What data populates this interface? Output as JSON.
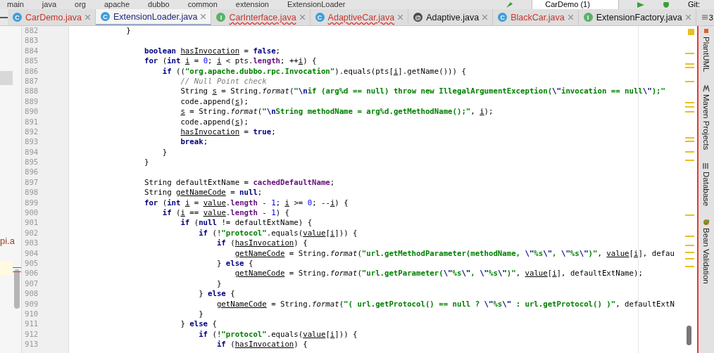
{
  "breadcrumbs": [
    "main",
    "java",
    "org",
    "apache",
    "dubbo",
    "common",
    "extension",
    "ExtensionLoader"
  ],
  "toolbar": {
    "run_config": "CarDemo (1)",
    "vcs_label": "Git:"
  },
  "project_panel": {
    "visible_text": "pi.a"
  },
  "tabs": [
    {
      "label": "CarDemo.java",
      "badge": "C",
      "kind": "class",
      "selected": false,
      "unversioned": true,
      "has_errors": false
    },
    {
      "label": "ExtensionLoader.java",
      "badge": "C",
      "kind": "class",
      "selected": true,
      "unversioned": false,
      "has_errors": false
    },
    {
      "label": "CarInterface.java",
      "badge": "I",
      "kind": "interface",
      "selected": false,
      "unversioned": true,
      "has_errors": true
    },
    {
      "label": "AdaptiveCar.java",
      "badge": "C",
      "kind": "class",
      "selected": false,
      "unversioned": true,
      "has_errors": true
    },
    {
      "label": "Adaptive.java",
      "badge": "@",
      "kind": "annotation",
      "selected": false,
      "unversioned": false,
      "has_errors": false
    },
    {
      "label": "BlackCar.java",
      "badge": "C",
      "kind": "class",
      "selected": false,
      "unversioned": true,
      "has_errors": false
    },
    {
      "label": "ExtensionFactory.java",
      "badge": "I",
      "kind": "interface",
      "selected": false,
      "unversioned": false,
      "has_errors": false
    }
  ],
  "tabs_overflow": "3",
  "editor": {
    "lines": [
      {
        "no": "882",
        "code": [
          {
            "text": "            }",
            "kind": "plain"
          }
        ]
      },
      {
        "no": "883"
      },
      {
        "no": "884",
        "code": [
          {
            "text": "                boolean ",
            "kind": "keyword"
          },
          {
            "text": "hasInvocation",
            "kind": "variable"
          },
          {
            "text": " = ",
            "kind": "plain"
          },
          {
            "text": "false",
            "kind": "keyword"
          },
          {
            "text": ";",
            "kind": "plain"
          }
        ]
      },
      {
        "no": "885",
        "code": [
          {
            "text": "                for",
            "kind": "keyword"
          },
          {
            "text": " (",
            "kind": "plain"
          },
          {
            "text": "int ",
            "kind": "keyword"
          },
          {
            "text": "i",
            "kind": "variable"
          },
          {
            "text": " = ",
            "kind": "plain"
          },
          {
            "text": "0",
            "kind": "number"
          },
          {
            "text": "; ",
            "kind": "plain"
          },
          {
            "text": "i",
            "kind": "variable"
          },
          {
            "text": " < pts.",
            "kind": "plain"
          },
          {
            "text": "length",
            "kind": "field"
          },
          {
            "text": "; ++",
            "kind": "plain"
          },
          {
            "text": "i",
            "kind": "variable"
          },
          {
            "text": ") {",
            "kind": "plain"
          }
        ]
      },
      {
        "no": "886",
        "code": [
          {
            "text": "                    if",
            "kind": "keyword"
          },
          {
            "text": " ((",
            "kind": "plain"
          },
          {
            "text": "\"org.apache.dubbo.rpc.Invocation\"",
            "kind": "string"
          },
          {
            "text": ").equals(pts[",
            "kind": "plain"
          },
          {
            "text": "i",
            "kind": "variable"
          },
          {
            "text": "].getName())) {",
            "kind": "plain"
          }
        ]
      },
      {
        "no": "887",
        "code": [
          {
            "text": "                        // Null Point check",
            "kind": "comment"
          }
        ]
      },
      {
        "no": "888",
        "code": [
          {
            "text": "                        String ",
            "kind": "plain"
          },
          {
            "text": "s",
            "kind": "variable"
          },
          {
            "text": " = String.",
            "kind": "plain"
          },
          {
            "text": "format",
            "kind": "method"
          },
          {
            "text": "(",
            "kind": "plain"
          },
          {
            "text": "\"",
            "kind": "string"
          },
          {
            "text": "\\n",
            "kind": "escape"
          },
          {
            "text": "if (arg%d == null) throw new IllegalArgumentException(",
            "kind": "string"
          },
          {
            "text": "\\\"",
            "kind": "escape"
          },
          {
            "text": "invocation == null",
            "kind": "string"
          },
          {
            "text": "\\\"",
            "kind": "escape"
          },
          {
            "text": ");\"",
            "kind": "string"
          }
        ]
      },
      {
        "no": "889",
        "code": [
          {
            "text": "                        code.append(",
            "kind": "plain"
          },
          {
            "text": "s",
            "kind": "variable"
          },
          {
            "text": ");",
            "kind": "plain"
          }
        ]
      },
      {
        "no": "890",
        "code": [
          {
            "text": "                        s",
            "kind": "variable"
          },
          {
            "text": " = String.",
            "kind": "plain"
          },
          {
            "text": "format",
            "kind": "method"
          },
          {
            "text": "(",
            "kind": "plain"
          },
          {
            "text": "\"",
            "kind": "string"
          },
          {
            "text": "\\n",
            "kind": "escape"
          },
          {
            "text": "String methodName = arg%d.getMethodName();\"",
            "kind": "string"
          },
          {
            "text": ", ",
            "kind": "plain"
          },
          {
            "text": "i",
            "kind": "variable"
          },
          {
            "text": ");",
            "kind": "plain"
          }
        ]
      },
      {
        "no": "891",
        "code": [
          {
            "text": "                        code.append(",
            "kind": "plain"
          },
          {
            "text": "s",
            "kind": "variable"
          },
          {
            "text": ");",
            "kind": "plain"
          }
        ]
      },
      {
        "no": "892",
        "code": [
          {
            "text": "                        hasInvocation",
            "kind": "variable"
          },
          {
            "text": " = ",
            "kind": "plain"
          },
          {
            "text": "true",
            "kind": "keyword"
          },
          {
            "text": ";",
            "kind": "plain"
          }
        ]
      },
      {
        "no": "893",
        "code": [
          {
            "text": "                        break",
            "kind": "keyword"
          },
          {
            "text": ";",
            "kind": "plain"
          }
        ]
      },
      {
        "no": "894",
        "code": [
          {
            "text": "                    }",
            "kind": "plain"
          }
        ]
      },
      {
        "no": "895",
        "code": [
          {
            "text": "                }",
            "kind": "plain"
          }
        ]
      },
      {
        "no": "896"
      },
      {
        "no": "897",
        "code": [
          {
            "text": "                String defaultExtName = ",
            "kind": "plain"
          },
          {
            "text": "cachedDefaultName",
            "kind": "field"
          },
          {
            "text": ";",
            "kind": "plain"
          }
        ]
      },
      {
        "no": "898",
        "code": [
          {
            "text": "                String ",
            "kind": "plain"
          },
          {
            "text": "getNameCode",
            "kind": "variable"
          },
          {
            "text": " = ",
            "kind": "plain"
          },
          {
            "text": "null",
            "kind": "keyword"
          },
          {
            "text": ";",
            "kind": "plain"
          }
        ]
      },
      {
        "no": "899",
        "code": [
          {
            "text": "                for",
            "kind": "keyword"
          },
          {
            "text": " (",
            "kind": "plain"
          },
          {
            "text": "int ",
            "kind": "keyword"
          },
          {
            "text": "i",
            "kind": "variable"
          },
          {
            "text": " = ",
            "kind": "plain"
          },
          {
            "text": "value",
            "kind": "variable"
          },
          {
            "text": ".",
            "kind": "plain"
          },
          {
            "text": "length",
            "kind": "field"
          },
          {
            "text": " - ",
            "kind": "plain"
          },
          {
            "text": "1",
            "kind": "number"
          },
          {
            "text": "; ",
            "kind": "plain"
          },
          {
            "text": "i",
            "kind": "variable"
          },
          {
            "text": " >= ",
            "kind": "plain"
          },
          {
            "text": "0",
            "kind": "number"
          },
          {
            "text": "; --",
            "kind": "plain"
          },
          {
            "text": "i",
            "kind": "variable"
          },
          {
            "text": ") {",
            "kind": "plain"
          }
        ]
      },
      {
        "no": "900",
        "code": [
          {
            "text": "                    if",
            "kind": "keyword"
          },
          {
            "text": " (",
            "kind": "plain"
          },
          {
            "text": "i",
            "kind": "variable"
          },
          {
            "text": " == ",
            "kind": "plain"
          },
          {
            "text": "value",
            "kind": "variable"
          },
          {
            "text": ".",
            "kind": "plain"
          },
          {
            "text": "length",
            "kind": "field"
          },
          {
            "text": " - ",
            "kind": "plain"
          },
          {
            "text": "1",
            "kind": "number"
          },
          {
            "text": ") {",
            "kind": "plain"
          }
        ]
      },
      {
        "no": "901",
        "code": [
          {
            "text": "                        if",
            "kind": "keyword"
          },
          {
            "text": " (",
            "kind": "plain"
          },
          {
            "text": "null",
            "kind": "keyword"
          },
          {
            "text": " != defaultExtName) {",
            "kind": "plain"
          }
        ]
      },
      {
        "no": "902",
        "code": [
          {
            "text": "                            if",
            "kind": "keyword"
          },
          {
            "text": " (!",
            "kind": "plain"
          },
          {
            "text": "\"protocol\"",
            "kind": "string"
          },
          {
            "text": ".equals(",
            "kind": "plain"
          },
          {
            "text": "value",
            "kind": "variable"
          },
          {
            "text": "[",
            "kind": "plain"
          },
          {
            "text": "i",
            "kind": "variable"
          },
          {
            "text": "])) {",
            "kind": "plain"
          }
        ]
      },
      {
        "no": "903",
        "code": [
          {
            "text": "                                if",
            "kind": "keyword"
          },
          {
            "text": " (",
            "kind": "plain"
          },
          {
            "text": "hasInvocation",
            "kind": "variable"
          },
          {
            "text": ") {",
            "kind": "plain"
          }
        ]
      },
      {
        "no": "904",
        "code": [
          {
            "text": "                                    getNameCode",
            "kind": "variable"
          },
          {
            "text": " = String.",
            "kind": "plain"
          },
          {
            "text": "format",
            "kind": "method"
          },
          {
            "text": "(",
            "kind": "plain"
          },
          {
            "text": "\"url.getMethodParameter(methodName, ",
            "kind": "string"
          },
          {
            "text": "\\\"",
            "kind": "escape"
          },
          {
            "text": "%s",
            "kind": "string"
          },
          {
            "text": "\\\"",
            "kind": "escape"
          },
          {
            "text": ", ",
            "kind": "string"
          },
          {
            "text": "\\\"",
            "kind": "escape"
          },
          {
            "text": "%s",
            "kind": "string"
          },
          {
            "text": "\\\"",
            "kind": "escape"
          },
          {
            "text": ")\"",
            "kind": "string"
          },
          {
            "text": ", ",
            "kind": "plain"
          },
          {
            "text": "value",
            "kind": "variable"
          },
          {
            "text": "[",
            "kind": "plain"
          },
          {
            "text": "i",
            "kind": "variable"
          },
          {
            "text": "], defau",
            "kind": "plain"
          }
        ]
      },
      {
        "no": "905",
        "code": [
          {
            "text": "                                } ",
            "kind": "plain"
          },
          {
            "text": "else",
            "kind": "keyword"
          },
          {
            "text": " {",
            "kind": "plain"
          }
        ]
      },
      {
        "no": "906",
        "code": [
          {
            "text": "                                    getNameCode",
            "kind": "variable"
          },
          {
            "text": " = String.",
            "kind": "plain"
          },
          {
            "text": "format",
            "kind": "method"
          },
          {
            "text": "(",
            "kind": "plain"
          },
          {
            "text": "\"url.getParameter(",
            "kind": "string"
          },
          {
            "text": "\\\"",
            "kind": "escape"
          },
          {
            "text": "%s",
            "kind": "string"
          },
          {
            "text": "\\\"",
            "kind": "escape"
          },
          {
            "text": ", ",
            "kind": "string"
          },
          {
            "text": "\\\"",
            "kind": "escape"
          },
          {
            "text": "%s",
            "kind": "string"
          },
          {
            "text": "\\\"",
            "kind": "escape"
          },
          {
            "text": ")\"",
            "kind": "string"
          },
          {
            "text": ", ",
            "kind": "plain"
          },
          {
            "text": "value",
            "kind": "variable"
          },
          {
            "text": "[",
            "kind": "plain"
          },
          {
            "text": "i",
            "kind": "variable"
          },
          {
            "text": "], defaultExtName);",
            "kind": "plain"
          }
        ]
      },
      {
        "no": "907",
        "code": [
          {
            "text": "                                }",
            "kind": "plain"
          }
        ]
      },
      {
        "no": "908",
        "code": [
          {
            "text": "                            } ",
            "kind": "plain"
          },
          {
            "text": "else",
            "kind": "keyword"
          },
          {
            "text": " {",
            "kind": "plain"
          }
        ]
      },
      {
        "no": "909",
        "code": [
          {
            "text": "                                getNameCode",
            "kind": "variable"
          },
          {
            "text": " = String.",
            "kind": "plain"
          },
          {
            "text": "format",
            "kind": "method"
          },
          {
            "text": "(",
            "kind": "plain"
          },
          {
            "text": "\"( url.getProtocol() == null ? ",
            "kind": "string"
          },
          {
            "text": "\\\"",
            "kind": "escape"
          },
          {
            "text": "%s",
            "kind": "string"
          },
          {
            "text": "\\\"",
            "kind": "escape"
          },
          {
            "text": " : url.getProtocol() )\"",
            "kind": "string"
          },
          {
            "text": ", defaultExtN",
            "kind": "plain"
          }
        ]
      },
      {
        "no": "910",
        "code": [
          {
            "text": "                            }",
            "kind": "plain"
          }
        ]
      },
      {
        "no": "911",
        "code": [
          {
            "text": "                        } ",
            "kind": "plain"
          },
          {
            "text": "else",
            "kind": "keyword"
          },
          {
            "text": " {",
            "kind": "plain"
          }
        ]
      },
      {
        "no": "912",
        "code": [
          {
            "text": "                            if",
            "kind": "keyword"
          },
          {
            "text": " (!",
            "kind": "plain"
          },
          {
            "text": "\"protocol\"",
            "kind": "string"
          },
          {
            "text": ".equals(",
            "kind": "plain"
          },
          {
            "text": "value",
            "kind": "variable"
          },
          {
            "text": "[",
            "kind": "plain"
          },
          {
            "text": "i",
            "kind": "variable"
          },
          {
            "text": "])) {",
            "kind": "plain"
          }
        ]
      },
      {
        "no": "913",
        "code": [
          {
            "text": "                                if",
            "kind": "keyword"
          },
          {
            "text": " (",
            "kind": "plain"
          },
          {
            "text": "hasInvocation",
            "kind": "variable"
          },
          {
            "text": ") {",
            "kind": "plain"
          }
        ]
      }
    ]
  },
  "tool_windows": [
    {
      "label": "PlantUML",
      "kind": "plantuml"
    },
    {
      "label": "Maven Projects",
      "kind": "maven"
    },
    {
      "label": "Database",
      "kind": "database"
    },
    {
      "label": "Bean Validation",
      "kind": "bean"
    }
  ]
}
